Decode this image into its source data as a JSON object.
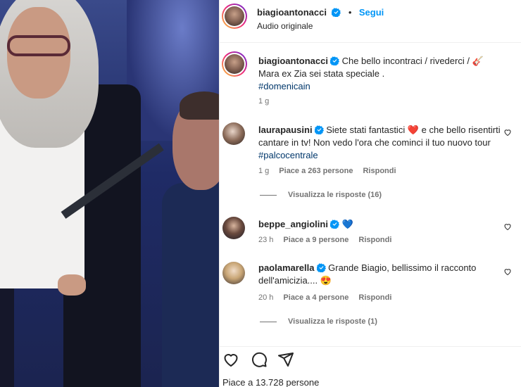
{
  "post": {
    "author": "biagioantonacci",
    "follow_label": "Segui",
    "dot": "•",
    "audio": "Audio originale"
  },
  "caption": {
    "author": "biagioantonacci",
    "text_line1": "Che bello incontraci / rivederci /",
    "guitar_emoji": "🎸",
    "text_line2": "Mara ex Zia sei stata speciale .",
    "hashtag": "#domenicain",
    "time": "1 g"
  },
  "comments": [
    {
      "user": "laurapausini",
      "text_a": "Siete stati fantastici",
      "emoji": "❤️",
      "text_b": "e che bello risentirti cantare in tv! Non vedo l'ora che cominci il tuo nuovo tour",
      "hashtag": "#palcocentrale",
      "time": "1 g",
      "likes": "Piace a 263 persone",
      "reply": "Rispondi",
      "view_replies": "Visualizza le risposte (16)"
    },
    {
      "user": "beppe_angiolini",
      "emoji": "💙",
      "time": "23 h",
      "likes": "Piace a 9 persone",
      "reply": "Rispondi"
    },
    {
      "user": "paolamarella",
      "text": "Grande Biagio, bellissimo il racconto dell'amicizia....",
      "emoji": "😍",
      "time": "20 h",
      "likes": "Piace a 4 persone",
      "reply": "Rispondi",
      "view_replies": "Visualizza le risposte (1)"
    }
  ],
  "footer": {
    "likes": "Piace a 13.728 persone"
  },
  "icons": {
    "verified": "verified-badge-icon",
    "like": "heart-icon",
    "comment": "comment-icon",
    "share": "share-icon",
    "comment_like": "small-heart-icon"
  },
  "colors": {
    "accent": "#0095f6",
    "verified": "#0095f6",
    "hashtag": "#00376b",
    "meta": "#737373"
  }
}
